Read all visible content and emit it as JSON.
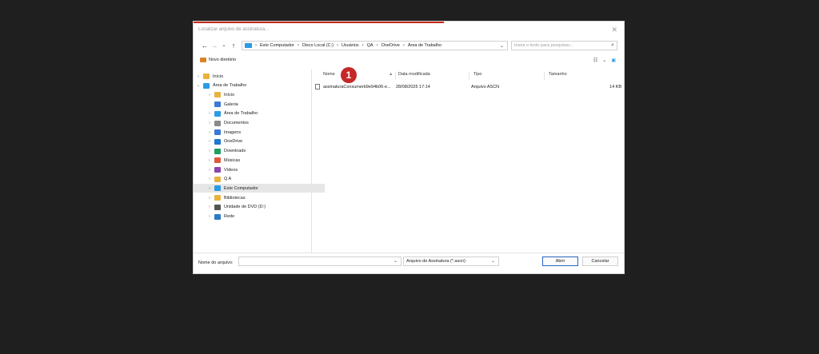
{
  "dialog": {
    "title": "Localizar arquivo de assinatura..."
  },
  "nav": {
    "back": "←",
    "forward": "→",
    "recent": "⌄",
    "up": "↑",
    "breadcrumb": [
      "Este Computador",
      "Disco Local (C:)",
      "Usuários",
      "QA",
      "OneDrive",
      "Área de Trabalho"
    ],
    "search_placeholder": "Insira o texto para pesquisar..."
  },
  "toolbar": {
    "new_folder": "Novo diretório"
  },
  "tree": [
    {
      "label": "Início",
      "indent": 0,
      "chev": "›",
      "icon": "home-icon",
      "color": "#e9b23c"
    },
    {
      "label": "Área de Trabalho",
      "indent": 0,
      "chev": "⌄",
      "icon": "desktop-icon",
      "color": "#2b9be6"
    },
    {
      "label": "Início",
      "indent": 1,
      "chev": "›",
      "icon": "home-icon",
      "color": "#e9b23c"
    },
    {
      "label": "Galeria",
      "indent": 1,
      "chev": "",
      "icon": "gallery-icon",
      "color": "#3a7bd5"
    },
    {
      "label": "Área de Trabalho",
      "indent": 1,
      "chev": "›",
      "icon": "desktop-icon",
      "color": "#2b9be6"
    },
    {
      "label": "Documentos",
      "indent": 1,
      "chev": "›",
      "icon": "documents-icon",
      "color": "#8a8a8a"
    },
    {
      "label": "Imagens",
      "indent": 1,
      "chev": "›",
      "icon": "pictures-icon",
      "color": "#3a7bd5"
    },
    {
      "label": "OneDrive",
      "indent": 1,
      "chev": "›",
      "icon": "cloud-icon",
      "color": "#1f78d1"
    },
    {
      "label": "Downloads",
      "indent": 1,
      "chev": "›",
      "icon": "download-icon",
      "color": "#1f9e60"
    },
    {
      "label": "Músicas",
      "indent": 1,
      "chev": "›",
      "icon": "music-icon",
      "color": "#e0583a"
    },
    {
      "label": "Vídeos",
      "indent": 1,
      "chev": "›",
      "icon": "videos-icon",
      "color": "#8e44ad"
    },
    {
      "label": "Q A",
      "indent": 1,
      "chev": "›",
      "icon": "folder-icon",
      "color": "#e9b23c"
    },
    {
      "label": "Este Computador",
      "indent": 1,
      "chev": "›",
      "icon": "computer-icon",
      "color": "#2b9be6",
      "selected": true
    },
    {
      "label": "Bibliotecas",
      "indent": 1,
      "chev": "›",
      "icon": "libraries-icon",
      "color": "#e9b23c"
    },
    {
      "label": "Unidade de DVD (D:)",
      "indent": 1,
      "chev": "›",
      "icon": "dvd-icon",
      "color": "#555555"
    },
    {
      "label": "Rede",
      "indent": 1,
      "chev": "›",
      "icon": "network-icon",
      "color": "#2b7bc4"
    }
  ],
  "columns": {
    "name": "Nome",
    "date": "Data modificada",
    "type": "Tipo",
    "size": "Tamanho"
  },
  "files": [
    {
      "name": "assinaturaConsumerb9e94b06-e...",
      "date": "28/08/2025 17:14",
      "type": "Arquivo ASCN",
      "size": "14 KB"
    }
  ],
  "annotation": {
    "number": "1"
  },
  "bottom": {
    "filename_label": "Nome do arquivo:",
    "filename_value": "",
    "filetype": "Arquivo de Assinatura (*.ascn)",
    "open": "Abrir",
    "cancel": "Cancelar"
  }
}
